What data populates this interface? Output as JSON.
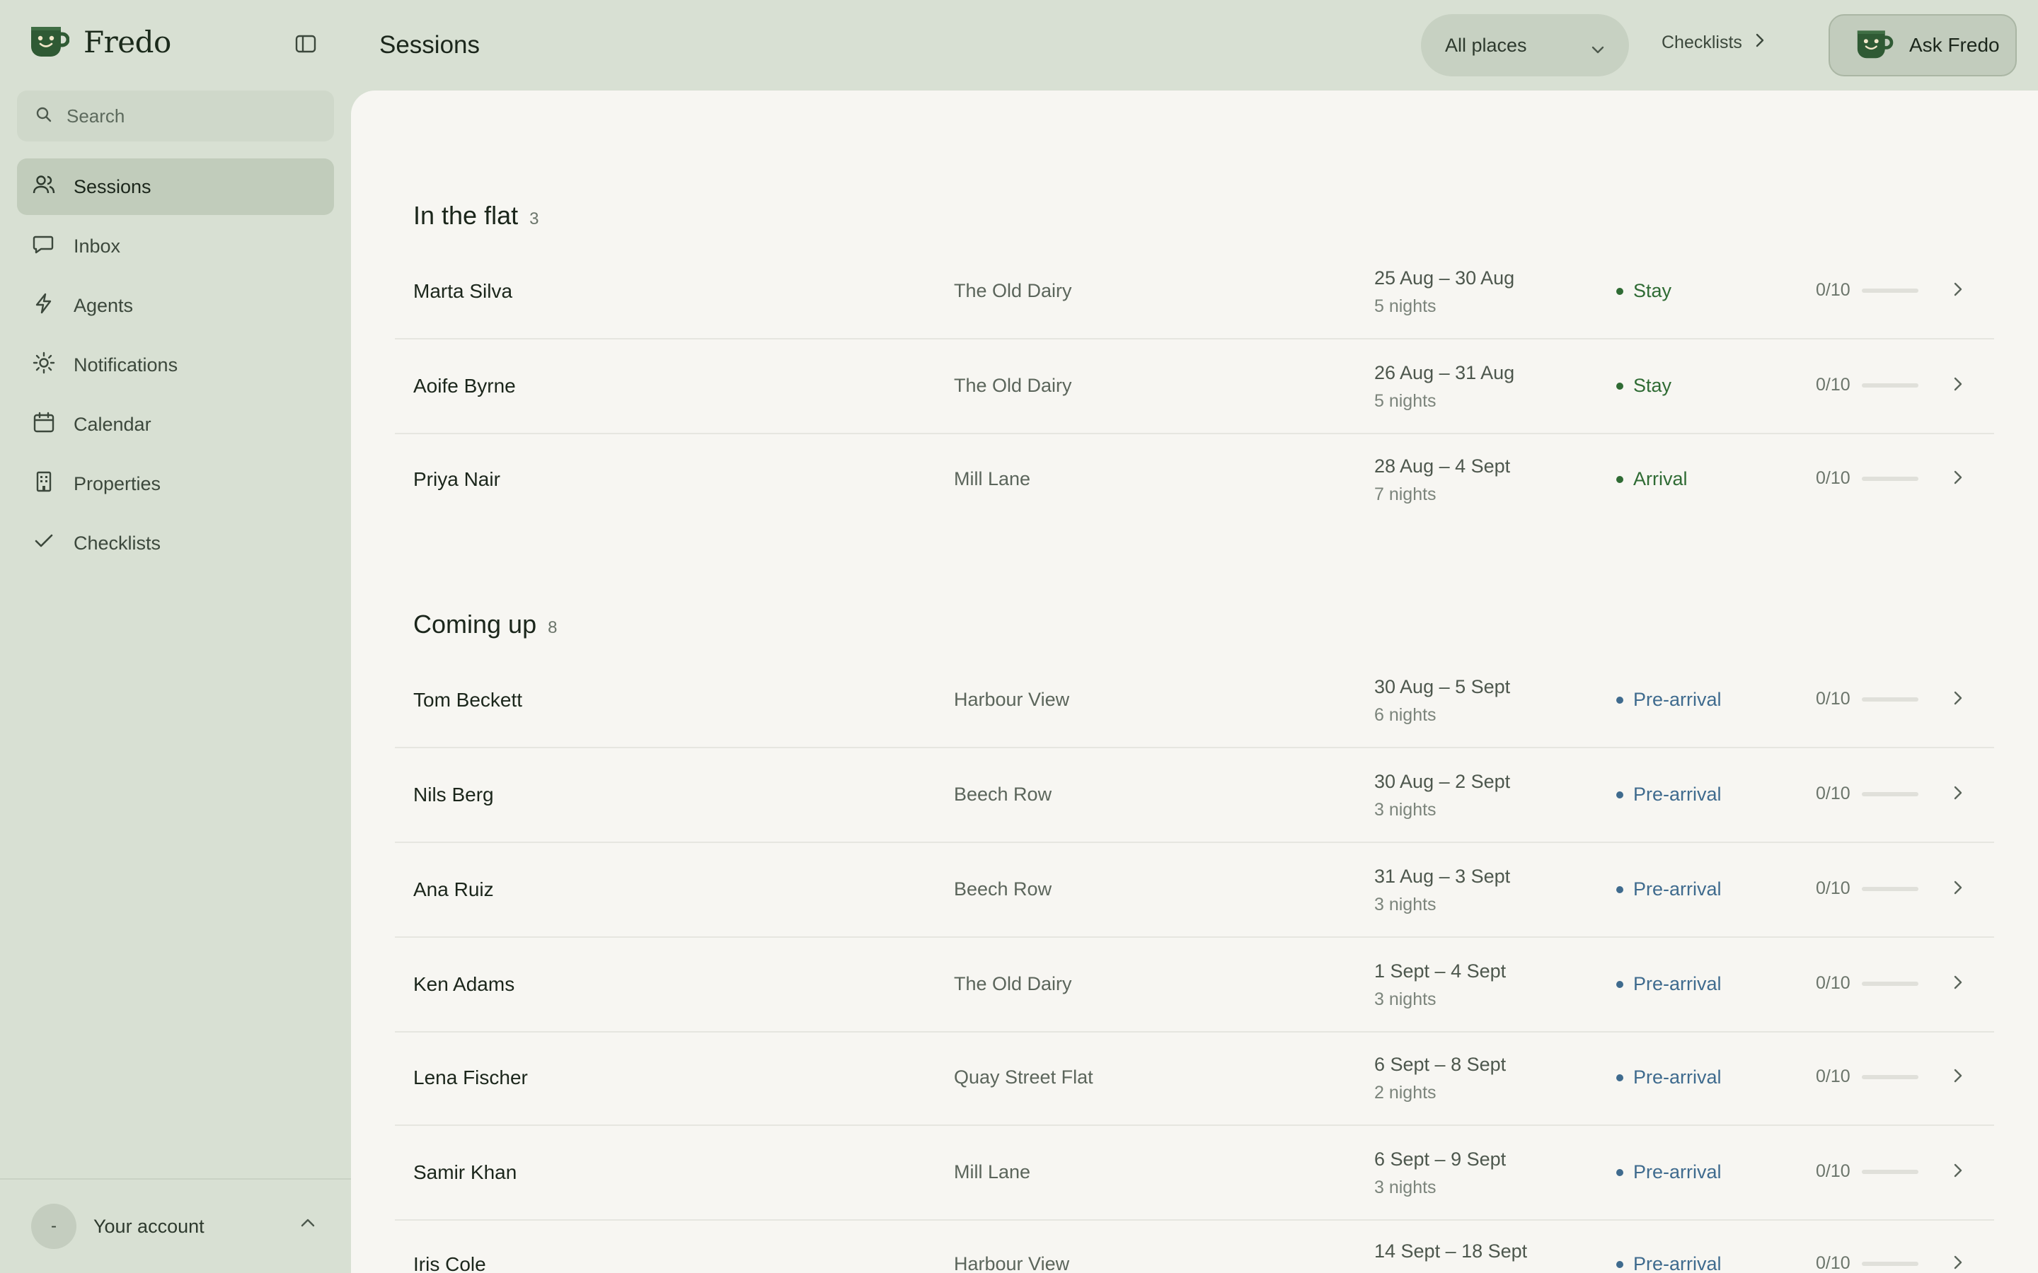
{
  "app": {
    "name": "Fredo"
  },
  "search": {
    "placeholder": "Search"
  },
  "sidebar": {
    "items": [
      {
        "label": "Sessions",
        "icon": "users-icon"
      },
      {
        "label": "Inbox",
        "icon": "message-icon"
      },
      {
        "label": "Agents",
        "icon": "bolt-icon"
      },
      {
        "label": "Notifications",
        "icon": "sun-icon"
      },
      {
        "label": "Calendar",
        "icon": "calendar-icon"
      },
      {
        "label": "Properties",
        "icon": "building-icon"
      },
      {
        "label": "Checklists",
        "icon": "check-icon"
      }
    ],
    "active": "Sessions",
    "account": {
      "avatar": "-",
      "label": "Your account"
    }
  },
  "header": {
    "title": "Sessions",
    "places_filter": "All places",
    "checklists_link": "Checklists",
    "ask_button": "Ask Fredo"
  },
  "colors": {
    "stay": "#2f6b34",
    "arrival": "#2f6b34",
    "pre_arrival": "#3f6b8e"
  },
  "sections": [
    {
      "title": "In the flat",
      "count": "3",
      "rows": [
        {
          "guest": "Marta Silva",
          "place": "The Old Dairy",
          "dates": "25 Aug – 30 Aug",
          "nights": "5 nights",
          "status": "Stay",
          "progress": "0/10"
        },
        {
          "guest": "Aoife Byrne",
          "place": "The Old Dairy",
          "dates": "26 Aug – 31 Aug",
          "nights": "5 nights",
          "status": "Stay",
          "progress": "0/10"
        },
        {
          "guest": "Priya Nair",
          "place": "Mill Lane",
          "dates": "28 Aug – 4 Sept",
          "nights": "7 nights",
          "status": "Arrival",
          "progress": "0/10"
        }
      ]
    },
    {
      "title": "Coming up",
      "count": "8",
      "rows": [
        {
          "guest": "Tom Beckett",
          "place": "Harbour View",
          "dates": "30 Aug – 5 Sept",
          "nights": "6 nights",
          "status": "Pre-arrival",
          "progress": "0/10"
        },
        {
          "guest": "Nils Berg",
          "place": "Beech Row",
          "dates": "30 Aug – 2 Sept",
          "nights": "3 nights",
          "status": "Pre-arrival",
          "progress": "0/10"
        },
        {
          "guest": "Ana Ruiz",
          "place": "Beech Row",
          "dates": "31 Aug – 3 Sept",
          "nights": "3 nights",
          "status": "Pre-arrival",
          "progress": "0/10"
        },
        {
          "guest": "Ken Adams",
          "place": "The Old Dairy",
          "dates": "1 Sept – 4 Sept",
          "nights": "3 nights",
          "status": "Pre-arrival",
          "progress": "0/10"
        },
        {
          "guest": "Lena Fischer",
          "place": "Quay Street Flat",
          "dates": "6 Sept – 8 Sept",
          "nights": "2 nights",
          "status": "Pre-arrival",
          "progress": "0/10"
        },
        {
          "guest": "Samir Khan",
          "place": "Mill Lane",
          "dates": "6 Sept – 9 Sept",
          "nights": "3 nights",
          "status": "Pre-arrival",
          "progress": "0/10"
        },
        {
          "guest": "Iris Cole",
          "place": "Harbour View",
          "dates": "14 Sept – 18 Sept",
          "nights": "",
          "status": "Pre-arrival",
          "progress": "0/10"
        }
      ]
    }
  ]
}
